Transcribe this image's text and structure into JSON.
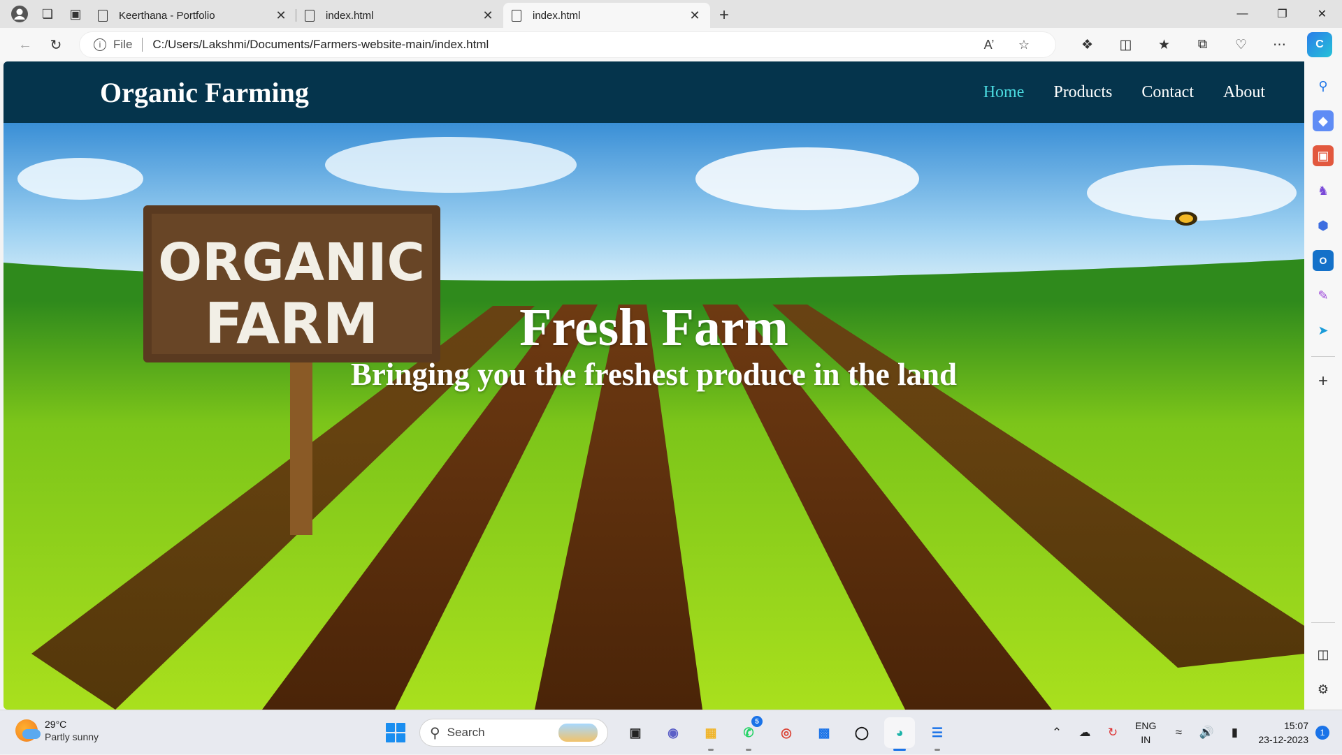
{
  "browser": {
    "tabs": [
      {
        "title": "Keerthana - Portfolio",
        "active": false
      },
      {
        "title": "index.html",
        "active": false
      },
      {
        "title": "index.html",
        "active": true
      }
    ],
    "address": {
      "scheme_label": "File",
      "url": "C:/Users/Lakshmi/Documents/Farmers-website-main/index.html"
    }
  },
  "site": {
    "logo": "Organic Farming",
    "nav": [
      {
        "label": "Home",
        "active": true
      },
      {
        "label": "Products",
        "active": false
      },
      {
        "label": "Contact",
        "active": false
      },
      {
        "label": "About",
        "active": false
      }
    ],
    "hero": {
      "sign_line1": "ORGANIC",
      "sign_line2": "FARM",
      "title": "Fresh Farm",
      "subtitle": "Bringing you the freshest produce in the land"
    }
  },
  "colors": {
    "header_bg": "#05344c",
    "nav_active": "#4bdbe0",
    "nav_text": "#ffffff"
  },
  "taskbar": {
    "weather": {
      "temp": "29°C",
      "condition": "Partly sunny"
    },
    "search_placeholder": "Search",
    "whatsapp_badge": "5",
    "lang_line1": "ENG",
    "lang_line2": "IN",
    "time": "15:07",
    "date": "23-12-2023",
    "notification_count": "1"
  }
}
